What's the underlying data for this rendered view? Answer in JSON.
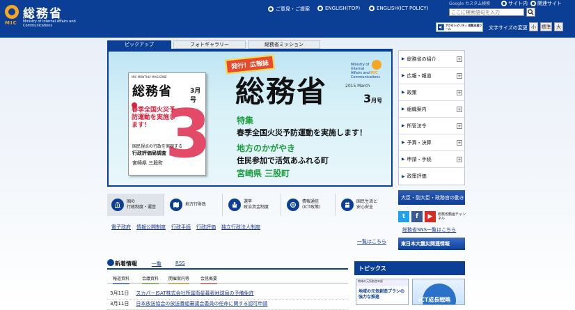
{
  "header": {
    "logo_title": "総務省",
    "logo_mic": "MIC",
    "logo_sub": "Ministry of Internal Affairs and Communications",
    "links": [
      {
        "label": "ご意見・ご提案"
      },
      {
        "label": "ENGLISH(TOP)"
      },
      {
        "label": "ENGLISH(ICT POLICY)"
      }
    ],
    "search": {
      "google_label": "Google カスタム検索",
      "scope_site": "サイト内",
      "scope_related": "関連サイト",
      "placeholder": "ここに検索語句を入力"
    },
    "accessibility_label": "アクセシビリティ 閲覧支援ツール",
    "fontsize_label": "文字サイズの変更",
    "fontsize_options": [
      "小",
      "標準",
      "大"
    ]
  },
  "tabs": [
    "ピックアップ",
    "フォトギャラリー",
    "総務省ミッション"
  ],
  "banner": {
    "mag_header": "MIC MONTHLY MAGAZINE",
    "mag_title": "総務省",
    "mag_month": "3月号",
    "mag_red": "春季全国火災予防運動を実施します！",
    "mag_sub": "行政評価局調査",
    "mag_sub2": "宮崎県 三股町",
    "mag_sub3": "国民視点の行政を実現する",
    "hakko": "発行！広報誌",
    "big_title": "総務省",
    "issue_en": "Ministry of Internal Affairs and Communications",
    "issue_year": "2015 March",
    "issue_month": "3",
    "issue_month_suffix": "月号",
    "mic_mini": "MIC",
    "tokushu": "特集",
    "tokushu_text": "春季全国火災予防運動を実施します！",
    "chiho": "地方のかがやき",
    "chiho_text": "住民参加で活気あふれる町",
    "chiho_place": "宮崎県 三股町"
  },
  "categories": [
    {
      "label": "国の\n行政制度・運営",
      "icon": "building-icon"
    },
    {
      "label": "地方行財政",
      "icon": "map-icon"
    },
    {
      "label": "選挙\n政治資金制度",
      "icon": "ballot-icon"
    },
    {
      "label": "情報通信\n(ICT政策)",
      "icon": "network-icon"
    },
    {
      "label": "国民生活と\n安心安全",
      "icon": "people-icon"
    }
  ],
  "sublinks": [
    "電子政府",
    "情報公開制度",
    "行政手続",
    "行政評価",
    "独立行政法人制度"
  ],
  "ichiran": "一覧はこちら",
  "news": {
    "title": "新着情報",
    "link_list": "一覧",
    "link_rss": "RSS",
    "tabs": [
      "報道資料",
      "会議資料",
      "開催案内等",
      "会見概要"
    ],
    "rows": [
      {
        "date": "3月11日",
        "text": "スカパーJSAT株式会社所属衛星幕張地球局の予備免許"
      },
      {
        "date": "3月11日",
        "text": "日本放送協会の放送番組審議会委員の任命に関する認可申請"
      }
    ]
  },
  "sidebar": {
    "items": [
      "総務省の紹介",
      "広報・報道",
      "政策",
      "組織案内",
      "所管法令",
      "予算・決算",
      "申請・手続",
      "政策評価"
    ],
    "daijin": "大臣・副大臣・政務官の動き",
    "youtube_label": "総務省動画チャンネル",
    "sns_link": "総務省SNS一覧はこちら",
    "shinsai": "東日本大震災関連情報",
    "topics": "トピックス",
    "card1_top": "地域の元気創造本部",
    "card1_main": "地域の元気創造プランの強力な推進",
    "card2_main": "ICT成長戦略"
  },
  "colors": {
    "brand_blue": "#0b3f96",
    "accent_orange": "#f5a623",
    "banner_green": "#1d9e3e",
    "magazine_pink": "#e24a67"
  }
}
